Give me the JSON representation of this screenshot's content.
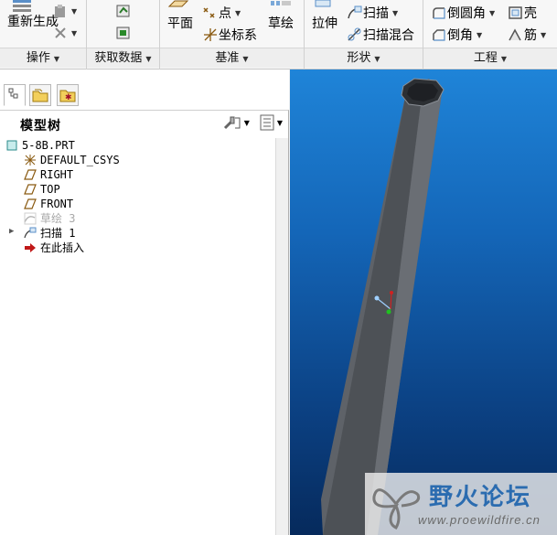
{
  "ribbon": {
    "groups": [
      {
        "label": "操作"
      },
      {
        "label": "获取数据"
      },
      {
        "label": "基准"
      },
      {
        "label": "形状"
      },
      {
        "label": "工程"
      }
    ],
    "regenerate_label": "重新生成",
    "plane_label": "平面",
    "point_label": "点",
    "csys_label": "坐标系",
    "sketch_label": "草绘",
    "extrude_label": "拉伸",
    "sweep_label": "扫描",
    "swept_blend_label": "扫描混合",
    "round_label": "倒圆角",
    "chamfer_label": "倒角",
    "shell_label": "壳",
    "rib_label": "筋"
  },
  "panel": {
    "title": "模型树"
  },
  "tree": {
    "items": [
      {
        "label": "5-8B.PRT",
        "icon": "part-icon"
      },
      {
        "label": "DEFAULT_CSYS",
        "icon": "csys-icon"
      },
      {
        "label": "RIGHT",
        "icon": "datum-plane-icon"
      },
      {
        "label": "TOP",
        "icon": "datum-plane-icon"
      },
      {
        "label": "FRONT",
        "icon": "datum-plane-icon"
      },
      {
        "label": "草绘 3",
        "icon": "sketch-icon"
      },
      {
        "label": "扫描 1",
        "icon": "sweep-icon"
      },
      {
        "label": "在此插入",
        "icon": "insert-arrow-icon"
      }
    ]
  },
  "watermark": {
    "title": "野火论坛",
    "url": "www.proewildfire.cn"
  },
  "colors": {
    "viewport_top": "#1f84d8",
    "viewport_bottom": "#062a5c",
    "model_gray": "#5a5e63",
    "watermark_blue": "#2b6cb0"
  }
}
